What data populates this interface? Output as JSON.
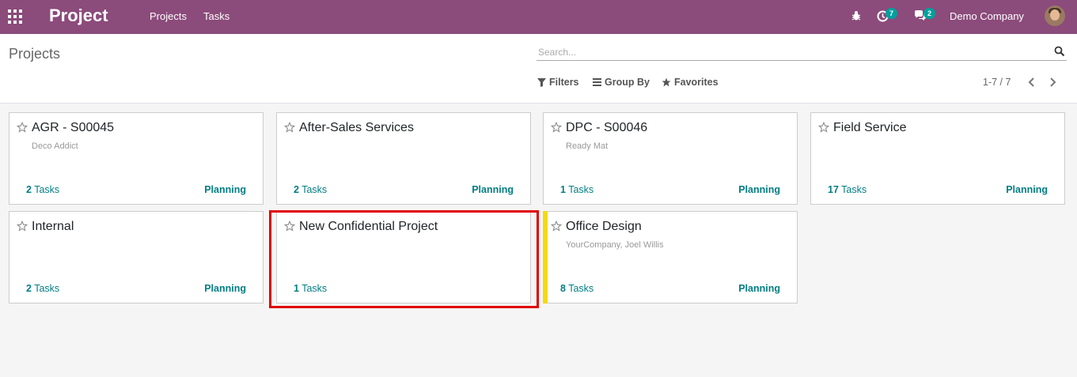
{
  "navbar": {
    "app_title": "Project",
    "menu": [
      "Projects",
      "Tasks"
    ],
    "activity_count": "7",
    "message_count": "2",
    "company": "Demo Company"
  },
  "control": {
    "breadcrumb": "Projects",
    "search_placeholder": "Search...",
    "filters_label": "Filters",
    "groupby_label": "Group By",
    "favorites_label": "Favorites",
    "pager": "1-7 / 7"
  },
  "projects": [
    {
      "name": "AGR - S00045",
      "customer": "Deco Addict",
      "tasks_count": "2",
      "tasks_label": "Tasks",
      "planning": "Planning"
    },
    {
      "name": "After-Sales Services",
      "customer": "",
      "tasks_count": "2",
      "tasks_label": "Tasks",
      "planning": "Planning"
    },
    {
      "name": "DPC - S00046",
      "customer": "Ready Mat",
      "tasks_count": "1",
      "tasks_label": "Tasks",
      "planning": "Planning"
    },
    {
      "name": "Field Service",
      "customer": "",
      "tasks_count": "17",
      "tasks_label": "Tasks",
      "planning": "Planning"
    },
    {
      "name": "Internal",
      "customer": "",
      "tasks_count": "2",
      "tasks_label": "Tasks",
      "planning": "Planning"
    },
    {
      "name": "New Confidential Project",
      "customer": "",
      "tasks_count": "1",
      "tasks_label": "Tasks",
      "planning": ""
    },
    {
      "name": "Office Design",
      "customer": "YourCompany, Joel Willis",
      "tasks_count": "8",
      "tasks_label": "Tasks",
      "planning": "Planning",
      "color": "#f4d914"
    }
  ],
  "colors": {
    "navbar": "#8b4b7b",
    "accent": "#017e84",
    "badge": "#00a09d",
    "highlight": "#e00000"
  }
}
